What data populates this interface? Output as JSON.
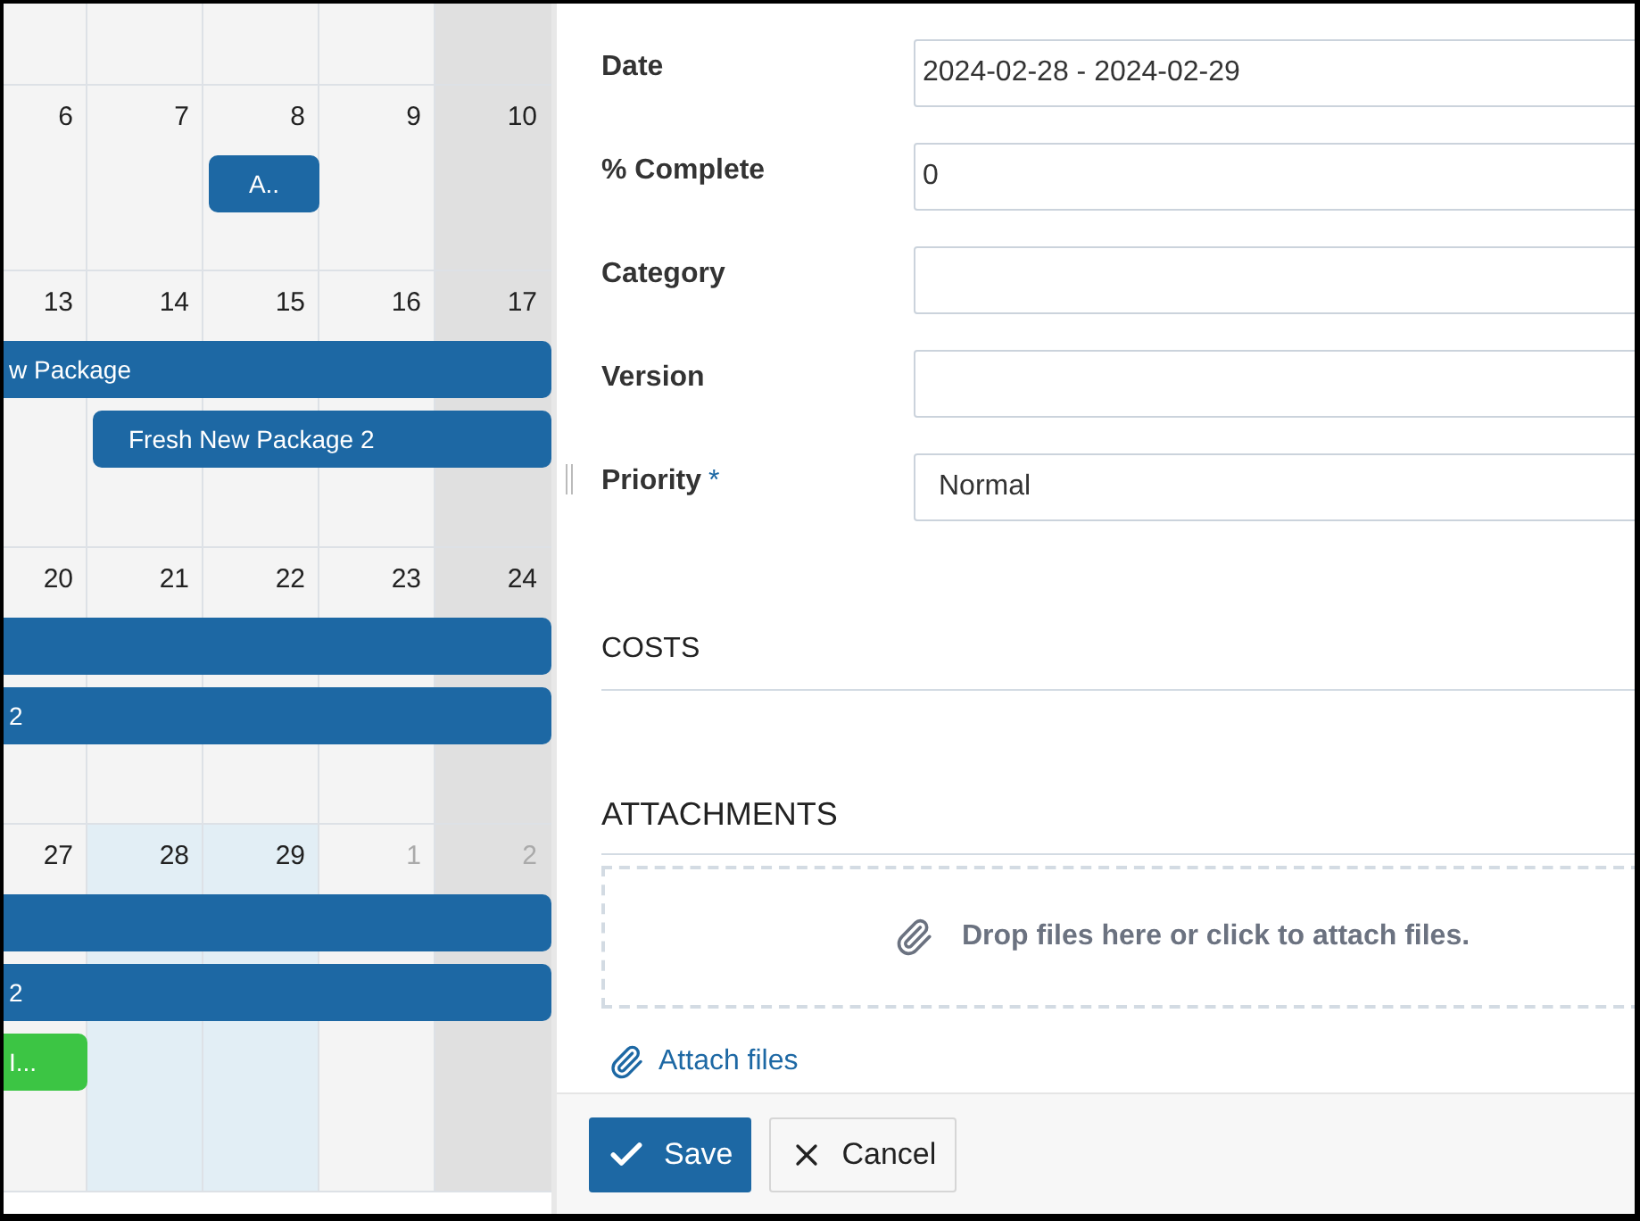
{
  "calendar": {
    "weeks": [
      {
        "days": [
          {
            "number": "6",
            "muted": false,
            "highlighted": false
          },
          {
            "number": "7",
            "muted": false,
            "highlighted": false
          },
          {
            "number": "8",
            "muted": false,
            "highlighted": false
          },
          {
            "number": "9",
            "muted": false,
            "highlighted": false
          },
          {
            "number": "10",
            "muted": false,
            "highlighted": false
          }
        ],
        "events": [
          {
            "label": "A..",
            "color": "#1d68a4",
            "continues_left": false
          }
        ]
      },
      {
        "days": [
          {
            "number": "13",
            "muted": false,
            "highlighted": false
          },
          {
            "number": "14",
            "muted": false,
            "highlighted": false
          },
          {
            "number": "15",
            "muted": false,
            "highlighted": false
          },
          {
            "number": "16",
            "muted": false,
            "highlighted": false
          },
          {
            "number": "17",
            "muted": false,
            "highlighted": false
          }
        ],
        "events": [
          {
            "label": "w Package",
            "color": "#1d68a4",
            "continues_left": true
          },
          {
            "label": "Fresh New Package 2",
            "color": "#1d68a4",
            "continues_left": false
          }
        ]
      },
      {
        "days": [
          {
            "number": "20",
            "muted": false,
            "highlighted": false
          },
          {
            "number": "21",
            "muted": false,
            "highlighted": false
          },
          {
            "number": "22",
            "muted": false,
            "highlighted": false
          },
          {
            "number": "23",
            "muted": false,
            "highlighted": false
          },
          {
            "number": "24",
            "muted": false,
            "highlighted": false
          }
        ],
        "events": [
          {
            "color": "#1d68a4",
            "continues_left": true
          },
          {
            "label": "2",
            "color": "#1d68a4",
            "continues_left": true
          }
        ]
      },
      {
        "days": [
          {
            "number": "27",
            "muted": false,
            "highlighted": false
          },
          {
            "number": "28",
            "muted": false,
            "highlighted": true
          },
          {
            "number": "29",
            "muted": false,
            "highlighted": true
          },
          {
            "number": "1",
            "muted": true,
            "highlighted": false
          },
          {
            "number": "2",
            "muted": true,
            "highlighted": false
          }
        ],
        "events": [
          {
            "color": "#1d68a4",
            "continues_left": true
          },
          {
            "label": "2",
            "color": "#1d68a4",
            "continues_left": true
          },
          {
            "label": "I...",
            "color": "#3cc544",
            "continues_left": true
          }
        ]
      }
    ]
  },
  "form": {
    "fields": [
      {
        "label": "Date",
        "kind": "text",
        "value": "2024-02-28 - 2024-02-29"
      },
      {
        "label": "% Complete",
        "kind": "text",
        "value": "0"
      },
      {
        "label": "Category",
        "kind": "text"
      },
      {
        "label": "Version",
        "kind": "text"
      },
      {
        "label": "Priority",
        "kind": "select",
        "required_mark": "*",
        "value": "Normal"
      }
    ],
    "costs": {
      "heading": "COSTS"
    },
    "attachments": {
      "heading": "ATTACHMENTS",
      "dropzone_text": "Drop files here or click to attach files.",
      "link": "Attach files"
    },
    "buttons": [
      {
        "kind": "primary",
        "label": "Save"
      },
      {
        "kind": "secondary",
        "label": "Cancel"
      }
    ]
  }
}
